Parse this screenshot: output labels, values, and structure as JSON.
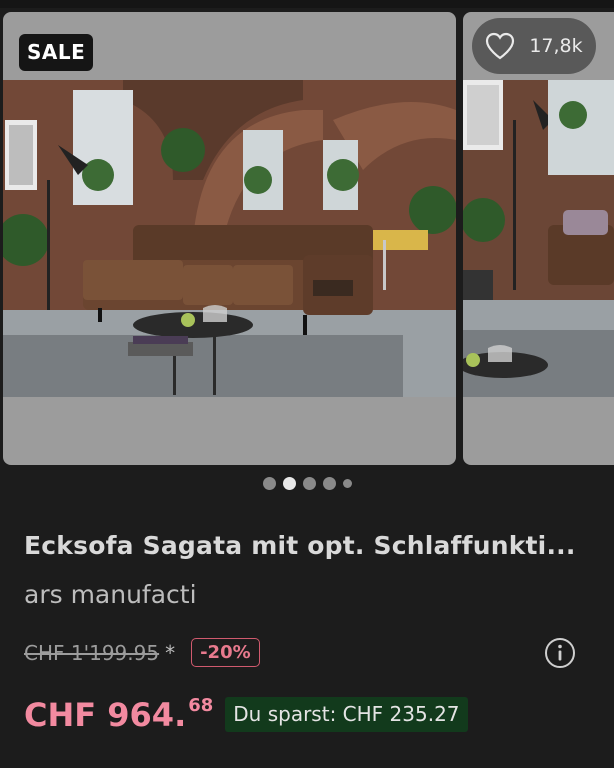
{
  "badge": {
    "label": "SALE"
  },
  "wishlist": {
    "count": "17,8k",
    "icon": "heart-outline-icon"
  },
  "carousel": {
    "total_dots": 5,
    "active_index": 1
  },
  "product": {
    "title": "Ecksofa Sagata mit opt. Schlaffunkti...",
    "brand": "ars manufacti"
  },
  "pricing": {
    "old_price": "CHF 1'199.95",
    "asterisk": "*",
    "discount": "-20%",
    "price_main": "CHF 964.",
    "price_cents": "68",
    "savings": "Du sparst: CHF 235.27",
    "info_icon": "info-circle-icon"
  },
  "colors": {
    "background": "#1c1c1c",
    "price": "#f28aa0",
    "discount_border": "#d05a6e",
    "savings_bg": "#123a1c",
    "badge_bg": "#151515"
  }
}
